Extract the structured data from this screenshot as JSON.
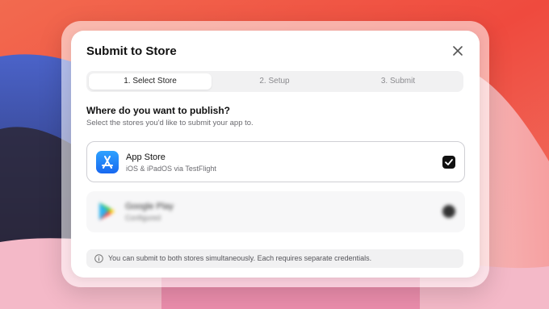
{
  "dialog": {
    "title": "Submit to Store",
    "steps": [
      {
        "label": "1. Select Store",
        "active": true
      },
      {
        "label": "2. Setup",
        "active": false
      },
      {
        "label": "3. Submit",
        "active": false
      }
    ],
    "question": "Where do you want to publish?",
    "subtitle": "Select the stores you'd like to submit your app to.",
    "stores": [
      {
        "name": "App Store",
        "description": "iOS & iPadOS via TestFlight",
        "selected": true,
        "icon": "app-store-icon"
      },
      {
        "name": "Google Play",
        "description": "Configured",
        "selected": false,
        "icon": "google-play-icon"
      }
    ],
    "info": "You can submit to both stores simultaneously. Each requires separate credentials."
  },
  "colors": {
    "accent": "#111111",
    "app_store_blue": "#1a7cf5"
  }
}
